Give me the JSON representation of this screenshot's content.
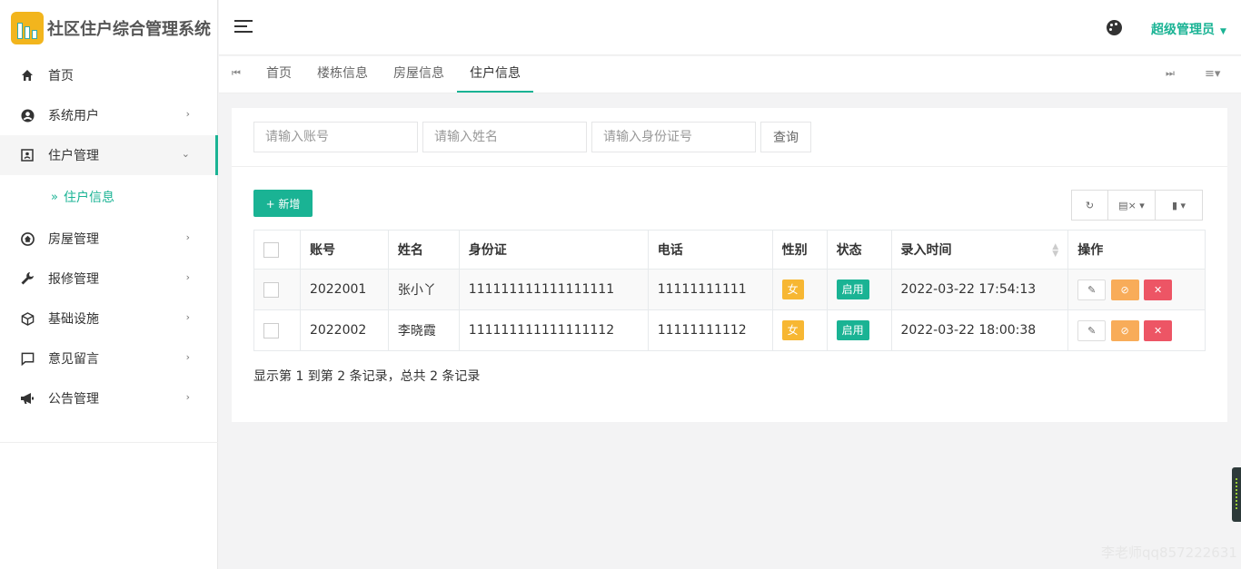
{
  "app": {
    "title": "社区住户综合管理系统"
  },
  "sidebar": {
    "items": [
      {
        "label": "首页",
        "icon": "home-icon",
        "chevron": ""
      },
      {
        "label": "系统用户",
        "icon": "user-circle-icon",
        "chevron": "›"
      },
      {
        "label": "住户管理",
        "icon": "contact-card-icon",
        "chevron": "⌄"
      },
      {
        "label": "房屋管理",
        "icon": "house-icon",
        "chevron": "›"
      },
      {
        "label": "报修管理",
        "icon": "wrench-icon",
        "chevron": "›"
      },
      {
        "label": "基础设施",
        "icon": "cube-icon",
        "chevron": "›"
      },
      {
        "label": "意见留言",
        "icon": "message-icon",
        "chevron": "›"
      },
      {
        "label": "公告管理",
        "icon": "megaphone-icon",
        "chevron": "›"
      }
    ],
    "submenu": {
      "label": "住户信息",
      "prefix": "»"
    }
  },
  "header": {
    "user": "超级管理员",
    "caret": "▼"
  },
  "tabs": {
    "items": [
      "首页",
      "楼栋信息",
      "房屋信息",
      "住户信息"
    ],
    "active": "住户信息",
    "nav_left": "⏮",
    "nav_right": "⏭",
    "menu": "≡▾"
  },
  "search": {
    "account_placeholder": "请输入账号",
    "name_placeholder": "请输入姓名",
    "idcard_placeholder": "请输入身份证号",
    "query_label": "查询"
  },
  "toolbar": {
    "add_label": "+ 新增",
    "refresh": "↻",
    "columns": "▤× ▾",
    "export": "▮ ▾"
  },
  "table": {
    "headers": [
      "账号",
      "姓名",
      "身份证",
      "电话",
      "性别",
      "状态",
      "录入时间",
      "操作"
    ],
    "rows": [
      {
        "account": "2022001",
        "name": "张小丫",
        "idcard": "111111111111111111",
        "phone": "11111111111",
        "sex": "女",
        "state": "启用",
        "time": "2022-03-22 17:54:13"
      },
      {
        "account": "2022002",
        "name": "李晓霞",
        "idcard": "111111111111111112",
        "phone": "11111111112",
        "sex": "女",
        "state": "启用",
        "time": "2022-03-22 18:00:38"
      }
    ],
    "op_icons": {
      "edit": "✎",
      "ban": "⊘",
      "delete": "✕"
    }
  },
  "pagination": {
    "summary": "显示第 1 到第 2 条记录，总共 2 条记录"
  },
  "watermark": "李老师qq857222631",
  "colors": {
    "accent": "#1ab394",
    "warning": "#f8ac59",
    "danger": "#ed5565",
    "badge_yellow": "#f7b733"
  }
}
